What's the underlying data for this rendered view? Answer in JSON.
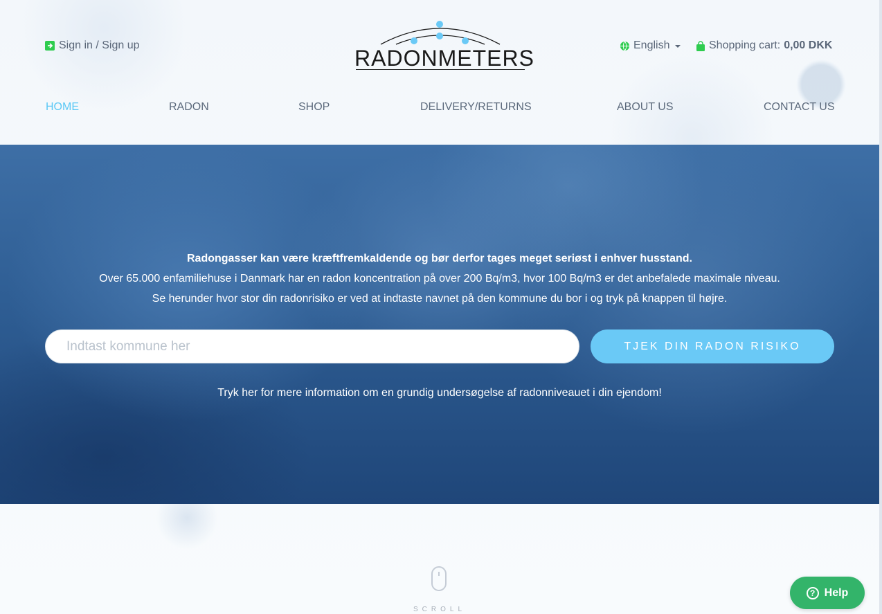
{
  "header": {
    "signin_label": "Sign in / Sign up",
    "logo_text": "RADONMETERS",
    "language_label": "English",
    "cart_label": "Shopping cart:",
    "cart_amount": "0,00 DKK"
  },
  "nav": {
    "items": [
      {
        "label": "HOME"
      },
      {
        "label": "RADON"
      },
      {
        "label": "SHOP"
      },
      {
        "label": "DELIVERY/RETURNS"
      },
      {
        "label": "ABOUT US"
      },
      {
        "label": "CONTACT US"
      }
    ]
  },
  "hero": {
    "headline": "Radongasser kan være kræftfremkaldende og bør derfor tages meget seriøst i enhver husstand.",
    "line2": "Over 65.000 enfamiliehuse i Danmark har en radon koncentration på over 200 Bq/m3, hvor 100 Bq/m3 er det anbefalede maximale niveau.",
    "line3": "Se herunder hvor stor din radonrisiko er ved at indtaste navnet på den kommune du bor i og tryk på knappen til højre.",
    "search_placeholder": "Indtast kommune her",
    "search_value": "",
    "button_label": "TJEK DIN RADON RISIKO",
    "more_link": "Tryk her for mere information om en grundig undersøgelse af radonniveauet i din ejendom!"
  },
  "scroll_label": "SCROLL",
  "help_label": "Help",
  "colors": {
    "accent": "#5bc8f5",
    "button": "#6ac9f6",
    "help": "#33b46a",
    "icon_green": "#2ecc4f"
  }
}
